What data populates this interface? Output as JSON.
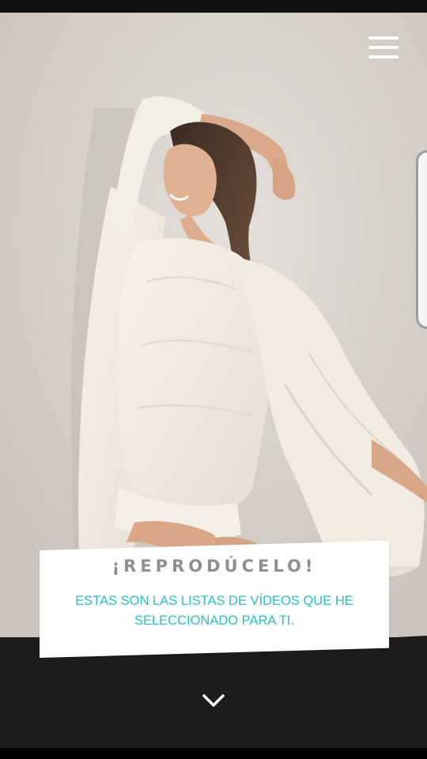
{
  "menu": {
    "icon": "hamburger-menu-icon"
  },
  "hero": {
    "image": "photo of a smiling woman in a white cardigan posing against a wall"
  },
  "card": {
    "title": "¡REPRODÚCELO!",
    "text": "ESTAS SON LAS LISTAS DE VÍDEOS QUE HE SELECCIONADO PARA TI."
  },
  "scroll": {
    "icon": "chevron-down-icon"
  },
  "colors": {
    "accent": "#2bbfc4",
    "title": "#8f8f8f",
    "band": "#1c1c1e",
    "card": "#ffffff"
  }
}
